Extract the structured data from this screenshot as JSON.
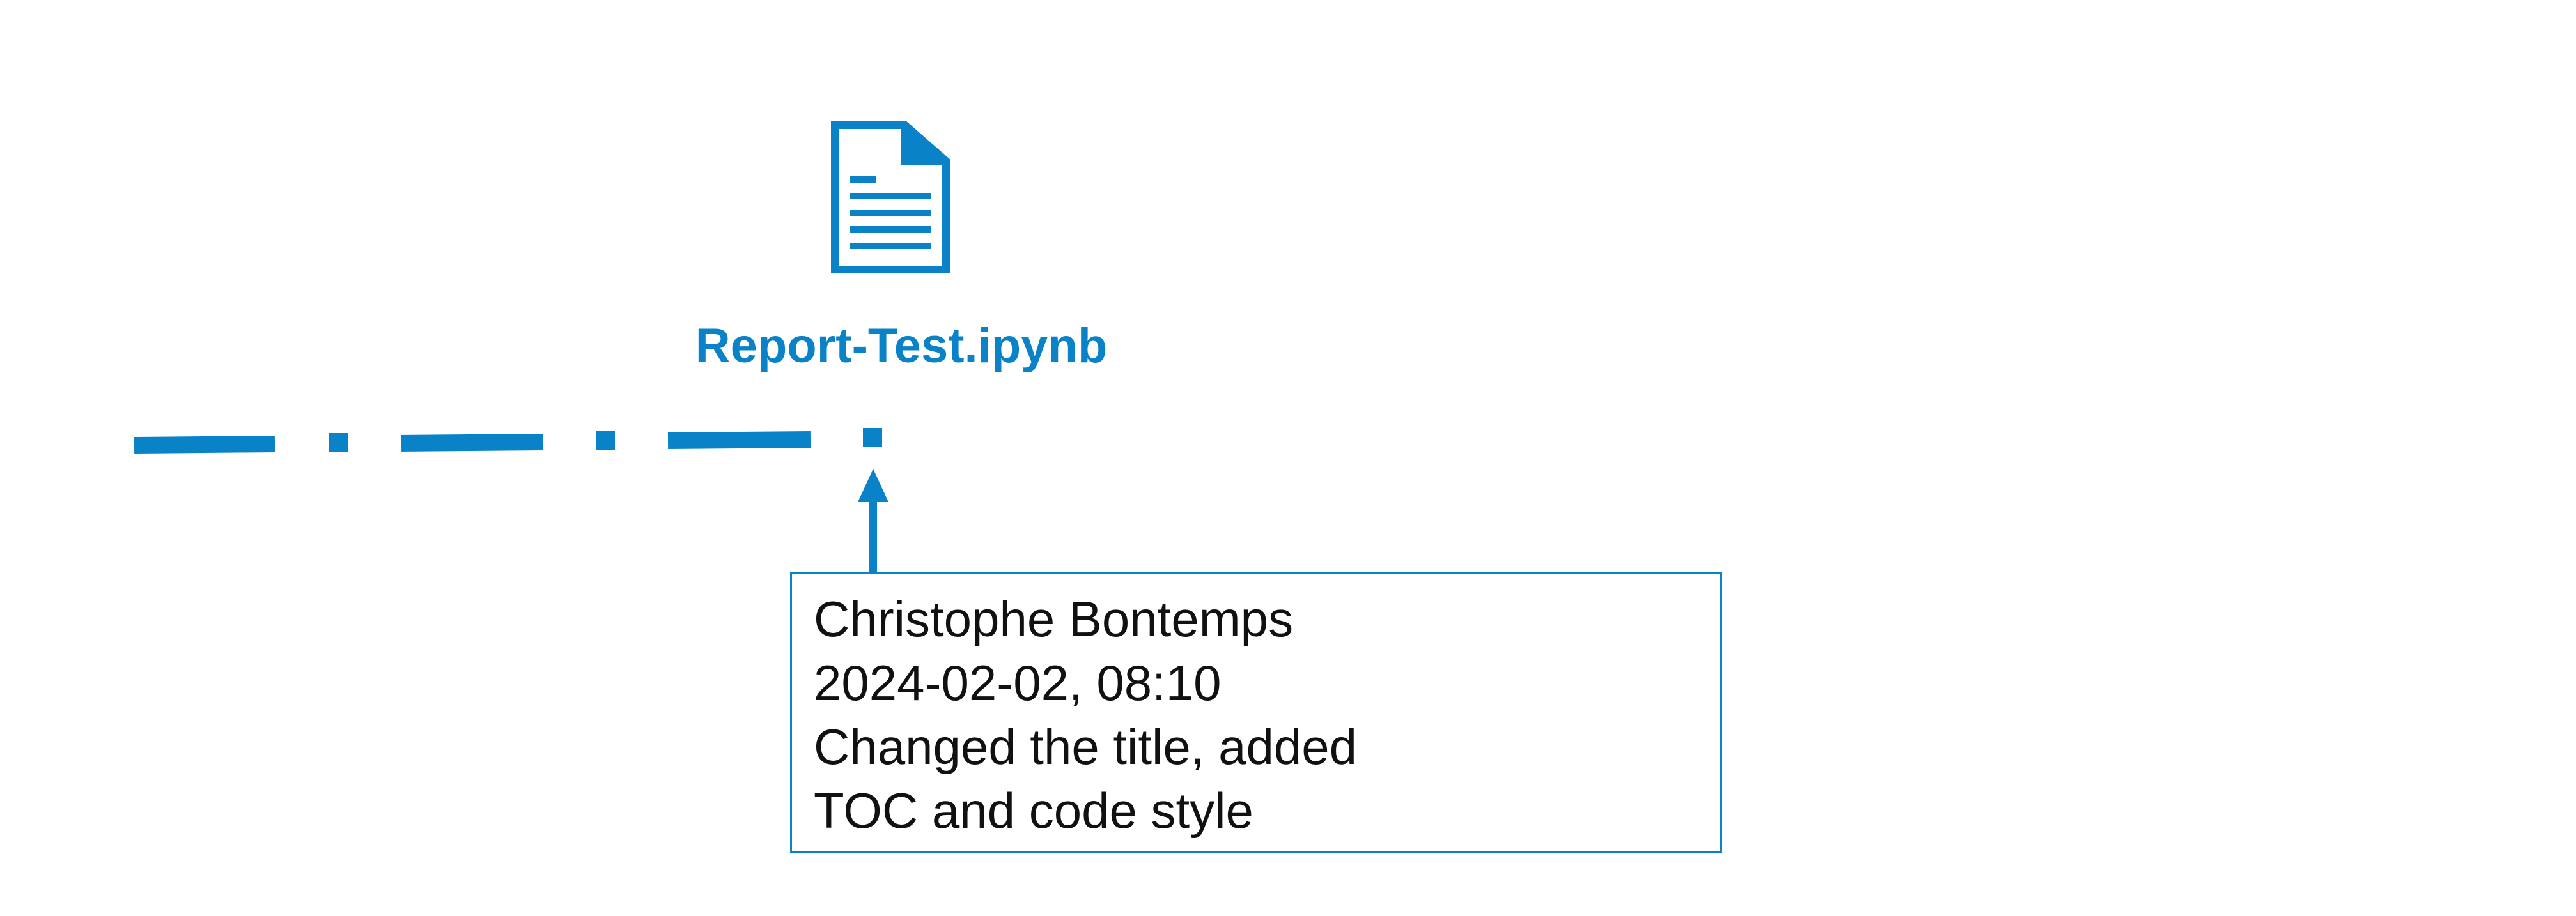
{
  "file": {
    "icon": "document-icon",
    "name": "Report-Test.ipynb"
  },
  "comment": {
    "author": "Christophe Bontemps",
    "timestamp": "2024-02-02, 08:10",
    "message_line1": "Changed the title, added",
    "message_line2": "TOC and code style"
  },
  "colors": {
    "accent": "#0a82c8",
    "text": "#111111"
  }
}
